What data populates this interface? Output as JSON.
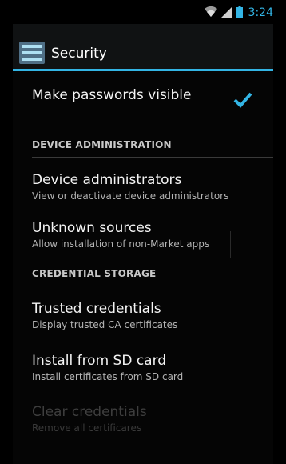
{
  "status_bar": {
    "time": "3:24",
    "icons": [
      "wifi-icon",
      "signal-icon",
      "battery-icon"
    ],
    "accent_color": "#33b5e5"
  },
  "action_bar": {
    "title": "Security",
    "icon": "settings-app-icon"
  },
  "settings": {
    "make_passwords_visible": {
      "title": "Make passwords visible",
      "checked": true
    },
    "device_administration_header": "DEVICE ADMINISTRATION",
    "device_administrators": {
      "title": "Device administrators",
      "summary": "View or deactivate device administrators"
    },
    "unknown_sources": {
      "title": "Unknown sources",
      "summary": "Allow installation of non-Market apps"
    },
    "credential_storage_header": "CREDENTIAL STORAGE",
    "trusted_credentials": {
      "title": "Trusted credentials",
      "summary": "Display trusted CA certificates"
    },
    "install_from_sd": {
      "title": "Install from SD card",
      "summary": "Install certificates from SD card"
    },
    "clear_credentials": {
      "title": "Clear credentials",
      "summary": "Remove all certificares",
      "enabled": false
    }
  }
}
